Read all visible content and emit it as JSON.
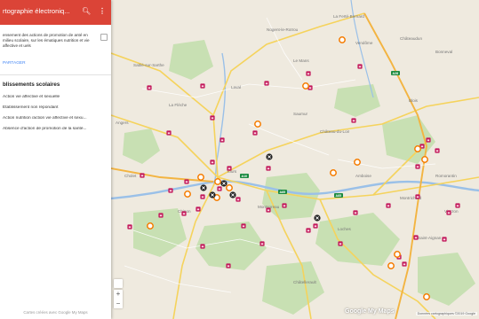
{
  "panel": {
    "title": "rtographie électroniq...",
    "description": "ensement des actions de promotion de anté en milieu scolaire, sur les ématiques nutrition et vie affective et uels",
    "share_label": "PARTAGER",
    "layer_title": "blissements scolaires",
    "layer_items": [
      "Action vie affective et sexuelle",
      "Etablissement non répondant",
      "Action nutrition /action vie affective et sexu...",
      "Absence d'action de promotion de la santé..."
    ],
    "credit": "Cartes créées avec Google My Maps"
  },
  "map": {
    "logo": "Google My Maps",
    "attribution": "Données cartographiques ©2019 Google",
    "icons": {
      "school": "school-icon",
      "ring": "ring-marker-icon",
      "cross": "cross-marker-icon"
    },
    "colors": {
      "header": "#db4437",
      "school_marker": "#c2185b",
      "ring_marker": "#f57c00",
      "cross_marker": "#222222",
      "road_major": "#f5d76e",
      "road_highway": "#f3b441",
      "water": "#9ac0e8",
      "forest": "#c5dfb0"
    },
    "places": [
      "La Ferté-Bernard",
      "Le Mans",
      "Sablé-sur-Sarthe",
      "La Flèche",
      "Saumur",
      "Angers",
      "Laval",
      "Cholet",
      "Montsoreau",
      "Blois",
      "Chinon",
      "Château-du-Loir",
      "Tours",
      "Vendôme",
      "Châteaudun",
      "Loches",
      "Amboise",
      "Bonneval",
      "Nogent-le-Rotrou",
      "Châtellerault",
      "Romorantin",
      "Montrichard",
      "Saint-Aignan",
      "Vierzon"
    ]
  }
}
